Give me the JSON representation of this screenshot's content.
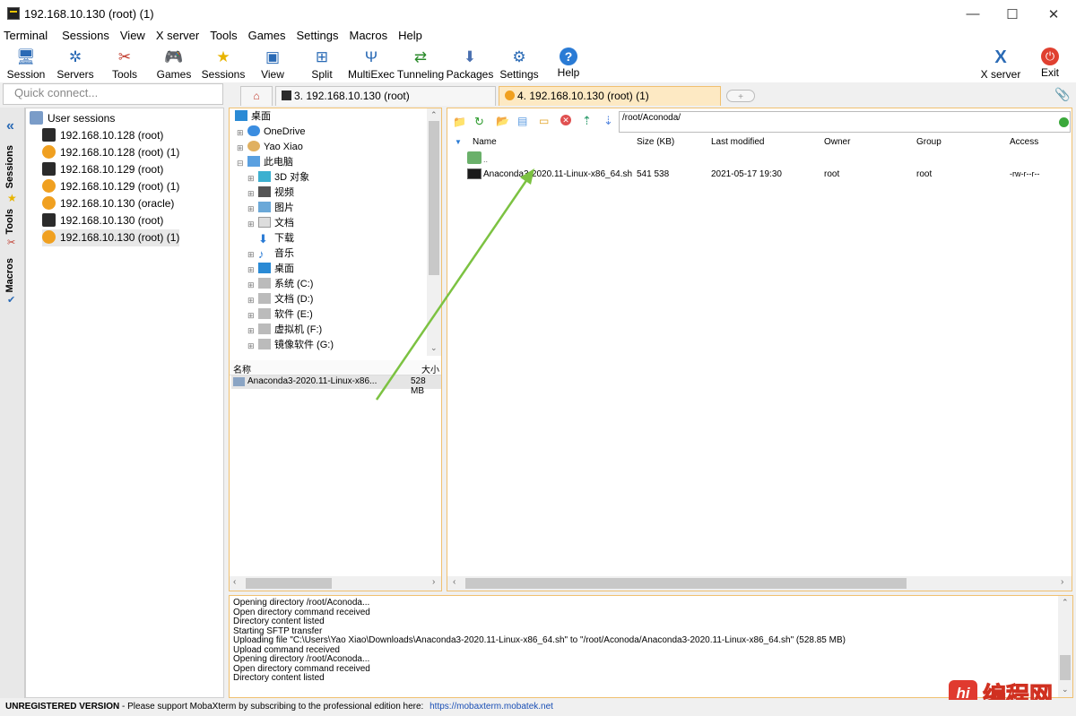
{
  "window": {
    "title": "192.168.10.130 (root) (1)",
    "min": "—",
    "max": "☐",
    "close": "✕"
  },
  "menu": [
    "Terminal",
    "Sessions",
    "View",
    "X server",
    "Tools",
    "Games",
    "Settings",
    "Macros",
    "Help"
  ],
  "toolbar": {
    "session": "Session",
    "servers": "Servers",
    "tools": "Tools",
    "games": "Games",
    "sessions": "Sessions",
    "view": "View",
    "split": "Split",
    "multiexec": "MultiExec",
    "tunneling": "Tunneling",
    "packages": "Packages",
    "settings": "Settings",
    "help": "Help",
    "xserver": "X server",
    "exit": "Exit"
  },
  "quick_connect": {
    "placeholder": "Quick connect..."
  },
  "tabs": {
    "tab3": "3. 192.168.10.130 (root)",
    "tab4": "4. 192.168.10.130 (root) (1)"
  },
  "sidetabs": {
    "sessions": "Sessions",
    "tools": "Tools",
    "macros": "Macros"
  },
  "sessions": {
    "root": "User sessions",
    "items": [
      "192.168.10.128 (root)",
      "192.168.10.128 (root) (1)",
      "192.168.10.129 (root)",
      "192.168.10.129 (root) (1)",
      "192.168.10.130 (oracle)",
      "192.168.10.130 (root)",
      "192.168.10.130 (root) (1)"
    ]
  },
  "local_tree": {
    "items": [
      "桌面",
      "OneDrive",
      "Yao Xiao",
      "此电脑",
      "3D 对象",
      "视频",
      "图片",
      "文档",
      "下载",
      "音乐",
      "桌面",
      "系统 (C:)",
      "文档 (D:)",
      "软件 (E:)",
      "虚拟机 (F:)",
      "镜像软件 (G:)"
    ]
  },
  "local_files": {
    "headers": {
      "name": "名称",
      "size": "大小"
    },
    "rows": [
      {
        "name": "Anaconda3-2020.11-Linux-x86...",
        "size": "528 MB"
      }
    ]
  },
  "remote": {
    "path": "/root/Aconoda/",
    "headers": {
      "name": "Name",
      "size": "Size (KB)",
      "modified": "Last modified",
      "owner": "Owner",
      "group": "Group",
      "access": "Access"
    },
    "parent": "..",
    "rows": [
      {
        "name": "Anaconda3-2020.11-Linux-x86_64.sh",
        "size": "541 538",
        "modified": "2021-05-17 19:30",
        "owner": "root",
        "group": "root",
        "access": "-rw-r--r--"
      }
    ]
  },
  "log": [
    "Opening directory /root/Aconoda...",
    "Open directory command received",
    "Directory content listed",
    "Starting SFTP transfer",
    "Uploading file \"C:\\Users\\Yao Xiao\\Downloads\\Anaconda3-2020.11-Linux-x86_64.sh\" to \"/root/Aconoda/Anaconda3-2020.11-Linux-x86_64.sh\" (528.85 MB)",
    "Upload command received",
    "Opening directory /root/Aconoda...",
    "Open directory command received",
    "Directory content listed"
  ],
  "status": {
    "label": "UNREGISTERED VERSION",
    "text": " -  Please support MobaXterm by subscribing to the professional edition here:",
    "link": "https://mobaxterm.mobatek.net"
  },
  "watermark": "编程网",
  "colors": {
    "tab_active": "#fde9c3",
    "pane_border": "#f0c070",
    "arrow": "#7cc242",
    "link": "#1a4fb5"
  }
}
